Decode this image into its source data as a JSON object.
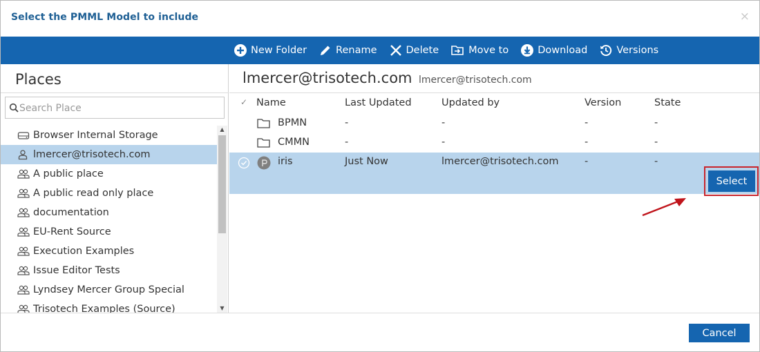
{
  "dialog": {
    "title": "Select the PMML Model to include",
    "close_glyph": "×"
  },
  "toolbar": {
    "items": [
      {
        "label": "New Folder",
        "icon": "plus-circle-icon"
      },
      {
        "label": "Rename",
        "icon": "pencil-icon"
      },
      {
        "label": "Delete",
        "icon": "x-icon"
      },
      {
        "label": "Move to",
        "icon": "move-folder-icon"
      },
      {
        "label": "Download",
        "icon": "download-circle-icon"
      },
      {
        "label": "Versions",
        "icon": "history-icon"
      }
    ]
  },
  "places": {
    "title": "Places",
    "search_placeholder": "Search Place",
    "items": [
      {
        "label": "Browser Internal Storage",
        "icon": "drive-icon"
      },
      {
        "label": "lmercer@trisotech.com",
        "icon": "user-icon",
        "selected": true
      },
      {
        "label": "A public place",
        "icon": "users-icon"
      },
      {
        "label": "A public read only place",
        "icon": "users-icon"
      },
      {
        "label": "documentation",
        "icon": "users-icon"
      },
      {
        "label": "EU-Rent Source",
        "icon": "users-icon"
      },
      {
        "label": "Execution Examples",
        "icon": "users-icon"
      },
      {
        "label": "Issue Editor Tests",
        "icon": "users-icon"
      },
      {
        "label": "Lyndsey Mercer Group Special",
        "icon": "users-icon"
      },
      {
        "label": "Trisotech Examples (Source)",
        "icon": "users-icon"
      }
    ]
  },
  "content": {
    "title": "lmercer@trisotech.com",
    "subtitle": "lmercer@trisotech.com",
    "columns": {
      "check": "✓",
      "name": "Name",
      "last_updated": "Last Updated",
      "updated_by": "Updated by",
      "version": "Version",
      "state": "State"
    },
    "rows": [
      {
        "name": "BPMN",
        "last_updated": "-",
        "updated_by": "-",
        "version": "-",
        "state": "-",
        "icon": "folder-icon"
      },
      {
        "name": "CMMN",
        "last_updated": "-",
        "updated_by": "-",
        "version": "-",
        "state": "-",
        "icon": "folder-icon"
      },
      {
        "name": "iris",
        "last_updated": "Just Now",
        "updated_by": "lmercer@trisotech.com",
        "version": "-",
        "state": "-",
        "icon": "pmml-model-icon",
        "selected": true
      }
    ],
    "select_label": "Select"
  },
  "footer": {
    "cancel_label": "Cancel"
  },
  "colors": {
    "accent": "#1565b0",
    "selection": "#b8d4ec",
    "title": "#1e5f94",
    "highlight_frame": "#c9242b"
  }
}
